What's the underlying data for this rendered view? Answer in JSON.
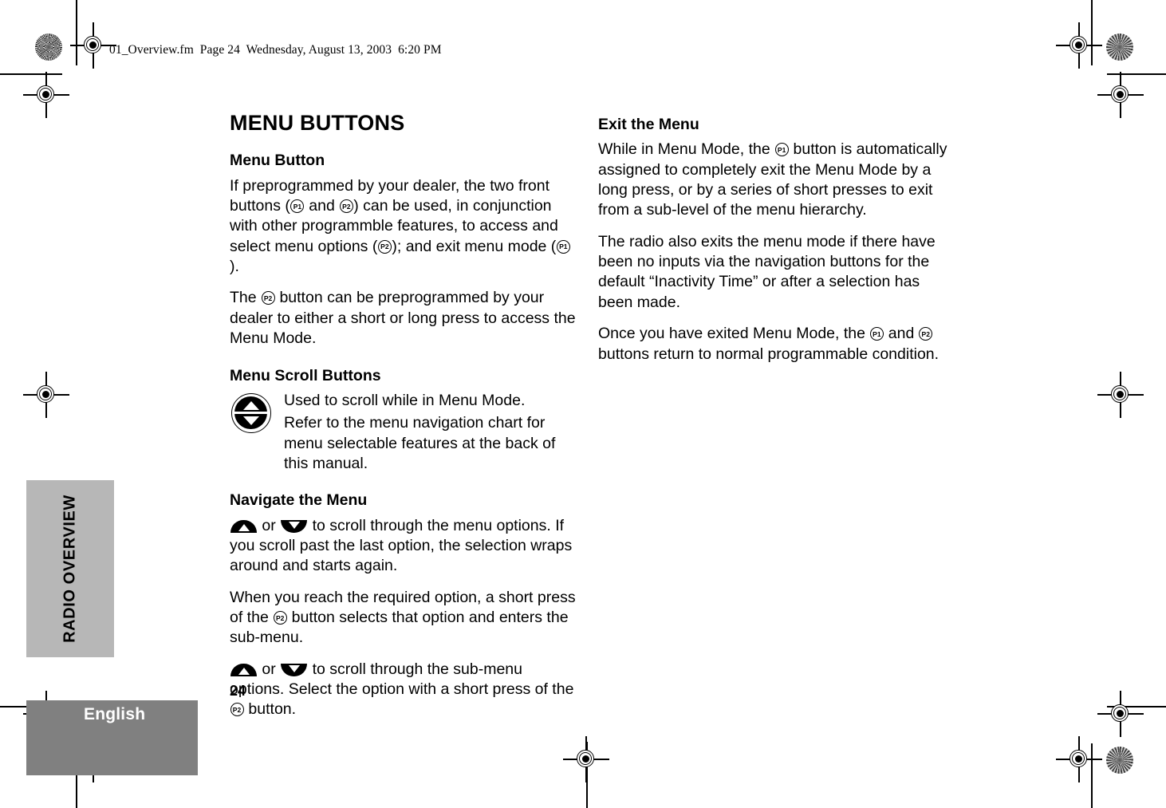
{
  "header": {
    "file_stamp": "01_Overview.fm  Page 24  Wednesday, August 13, 2003  6:20 PM"
  },
  "chapter_tab": {
    "label": "RADIO OVERVIEW"
  },
  "footer": {
    "language": "English",
    "page_number": "24"
  },
  "icons": {
    "p1": "P1",
    "p2": "P2"
  },
  "left_column": {
    "title": "MENU BUTTONS",
    "menu_button": {
      "heading": "Menu Button",
      "para1_a": "If preprogrammed by your dealer, the two front buttons (",
      "para1_b": " and ",
      "para1_c": ") can be used, in conjunction with other programmble features, to access and select menu options (",
      "para1_d": "); and exit menu mode (",
      "para1_e": ").",
      "para2_a": "The ",
      "para2_b": " button can be preprogrammed by your dealer to either a short or long press to access the Menu Mode."
    },
    "menu_scroll": {
      "heading": "Menu Scroll Buttons",
      "line1": "Used to scroll while in Menu Mode.",
      "line2": "Refer to the menu navigation chart for menu selectable features at the back of this manual."
    },
    "navigate": {
      "heading": "Navigate the Menu",
      "para1_or": " or ",
      "para1_tail": " to scroll through the menu options. If you scroll past the last option, the selection wraps around and starts again.",
      "para2_a": "When you reach the required option, a short press of the ",
      "para2_b": " button selects that option and enters the sub-menu.",
      "para3_or": " or ",
      "para3_mid": " to scroll through the sub-menu options. Select the option with a short press of the ",
      "para3_tail": " button."
    }
  },
  "right_column": {
    "exit_menu": {
      "heading": "Exit the Menu",
      "para1_a": "While in Menu Mode, the ",
      "para1_b": " button is automatically assigned to completely exit the Menu Mode by a long press, or by a series of short presses to exit from a sub-level of the menu hierarchy.",
      "para2": "The radio also exits the menu mode if there have been no inputs via the navigation buttons for the default “Inactivity Time” or after a selection has been made.",
      "para3_a": "Once you have exited Menu Mode, the ",
      "para3_b": " and ",
      "para3_c": " buttons return to normal programmable condition."
    }
  }
}
